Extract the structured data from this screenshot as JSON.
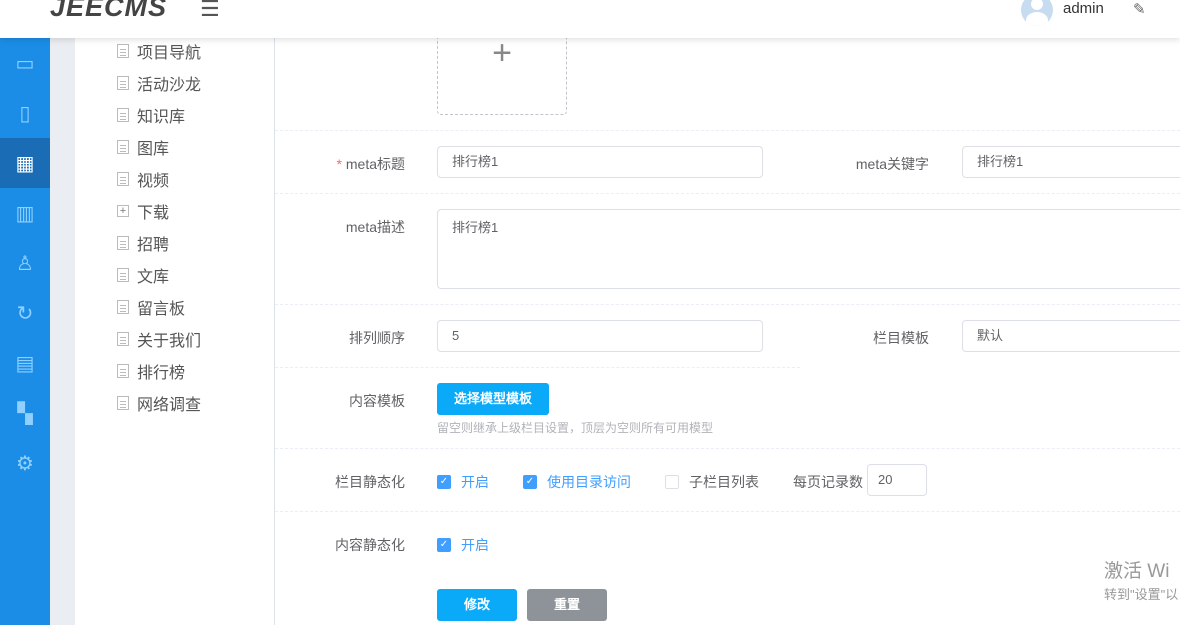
{
  "header": {
    "logo": "JEECMS",
    "menu_icon": "☰",
    "username": "admin"
  },
  "rail": [
    "monitor-icon",
    "document-icon",
    "grid-icon",
    "chart-icon",
    "user-icon",
    "refresh-icon",
    "box-icon",
    "apps-icon",
    "gear-icon"
  ],
  "tree": [
    {
      "label": "项目导航",
      "type": "doc"
    },
    {
      "label": "活动沙龙",
      "type": "doc"
    },
    {
      "label": "知识库",
      "type": "doc"
    },
    {
      "label": "图库",
      "type": "doc"
    },
    {
      "label": "视频",
      "type": "doc"
    },
    {
      "label": "下载",
      "type": "folder"
    },
    {
      "label": "招聘",
      "type": "doc"
    },
    {
      "label": "文库",
      "type": "doc"
    },
    {
      "label": "留言板",
      "type": "doc"
    },
    {
      "label": "关于我们",
      "type": "doc"
    },
    {
      "label": "排行榜",
      "type": "doc"
    },
    {
      "label": "网络调查",
      "type": "doc"
    }
  ],
  "form": {
    "upload_plus": "+",
    "meta_title_label": "meta标题",
    "meta_title": "排行榜1",
    "meta_keywords_label": "meta关键字",
    "meta_keywords": "排行榜1",
    "meta_desc_label": "meta描述",
    "meta_desc": "排行榜1",
    "order_label": "排列顺序",
    "order": "5",
    "channel_tpl_label": "栏目模板",
    "channel_tpl": "默认",
    "content_tpl_label": "内容模板",
    "choose_model_btn": "选择模型模板",
    "hint": "留空则继承上级栏目设置，顶层为空则所有可用模型",
    "channel_static_label": "栏目静态化",
    "enable": "开启",
    "use_dir": "使用目录访问",
    "sub_list": "子栏目列表",
    "per_page_label": "每页记录数",
    "per_page": "20",
    "content_static_label": "内容静态化",
    "content_enable": "开启",
    "submit": "修改",
    "reset": "重置"
  },
  "watermark": {
    "line1": "激活 Wi",
    "line2": "转到\"设置\"以"
  }
}
